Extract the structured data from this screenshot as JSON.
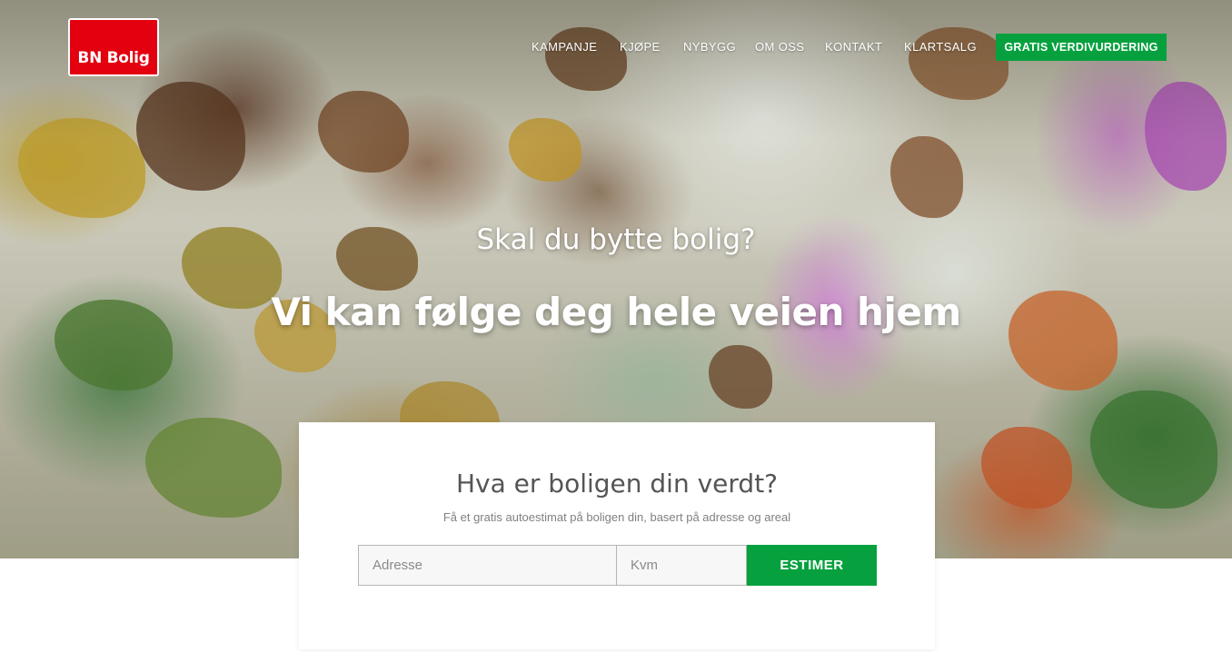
{
  "brand": {
    "logo_text": "BN Bolig",
    "color": "#e3000f"
  },
  "nav": {
    "items": [
      "KAMPANJE",
      "KJØPE",
      "NYBYGG",
      "OM OSS",
      "KONTAKT",
      "KLARTSALG"
    ],
    "cta_label": "GRATIS VERDIVURDERING",
    "cta_color": "#06a13e"
  },
  "hero": {
    "subtitle": "Skal du bytte bolig?",
    "title": "Vi kan følge deg hele veien hjem"
  },
  "valuation": {
    "title": "Hva er boligen din verdt?",
    "subtitle": "Få et gratis autoestimat på boligen din, basert på adresse og areal",
    "address_placeholder": "Adresse",
    "address_value": "",
    "area_placeholder": "Kvm",
    "area_value": "",
    "submit_label": "ESTIMER"
  }
}
